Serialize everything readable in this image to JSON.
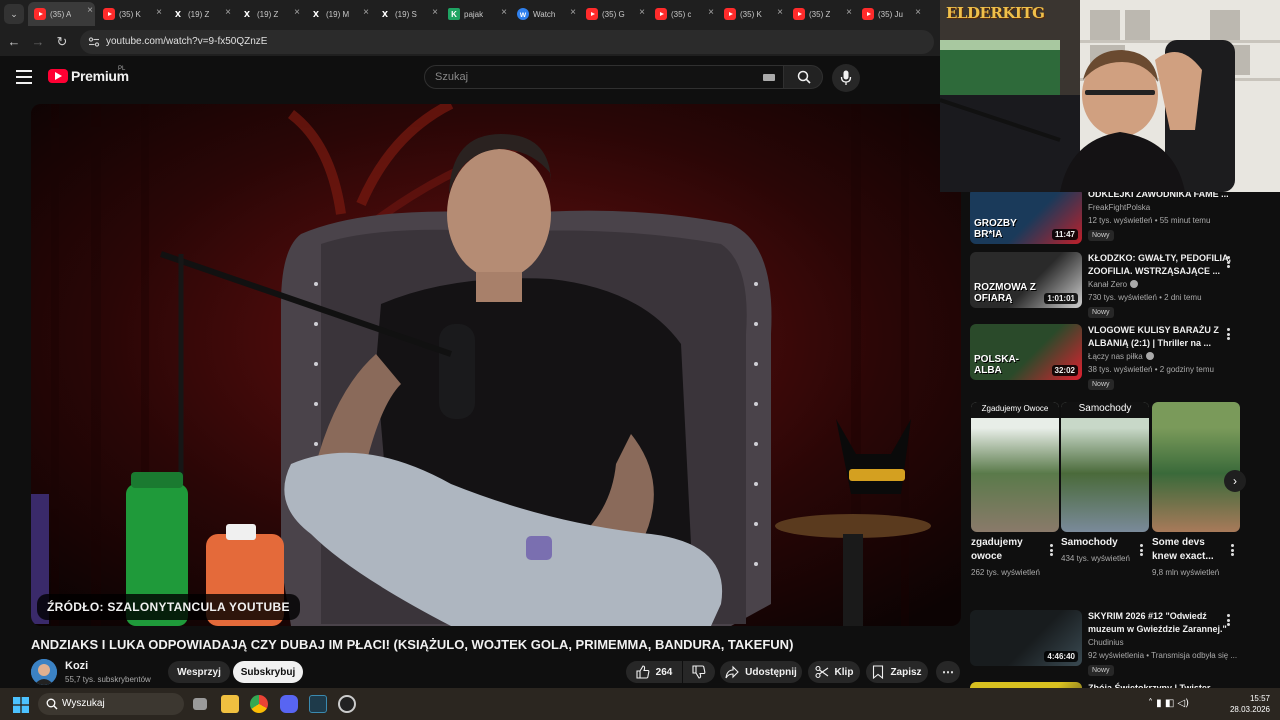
{
  "browser": {
    "tabs": [
      {
        "icon": "youtube-icon",
        "label": "(35) A"
      },
      {
        "icon": "youtube-icon",
        "label": "(35) K"
      },
      {
        "icon": "x-icon",
        "label": "(19) Z"
      },
      {
        "icon": "x-icon",
        "label": "(19) Z"
      },
      {
        "icon": "x-icon",
        "label": "(19) M"
      },
      {
        "icon": "x-icon",
        "label": "(19) S"
      },
      {
        "icon": "kick-icon",
        "label": "pajak"
      },
      {
        "icon": "watch-icon",
        "label": "Watch"
      },
      {
        "icon": "youtube-icon",
        "label": "(35) G"
      },
      {
        "icon": "youtube-icon",
        "label": "(35) c"
      },
      {
        "icon": "youtube-icon",
        "label": "(35) K"
      },
      {
        "icon": "youtube-icon",
        "label": "(35) Z"
      },
      {
        "icon": "youtube-icon",
        "label": "(35) Ju"
      }
    ],
    "url": "youtube.com/watch?v=9-fx50QZnzE"
  },
  "youtube": {
    "logo_text": "Premium",
    "logo_country": "PL",
    "search_placeholder": "Szukaj"
  },
  "video": {
    "source_caption": "ŹRÓDŁO: SZALONYTANCULA YOUTUBE",
    "title": "ANDZIAKS I LUKA ODPOWIADAJĄ CZY DUBAJ IM PŁACI! (KSIĄŻULO, WOJTEK GOLA, PRIMEMMA, BANDURA, TAKEFUN)",
    "channel_name": "Kozi",
    "channel_subscribers": "55,7 tys. subskrybentów",
    "support_label": "Wesprzyj",
    "subscribe_label": "Subskrybuj",
    "like_count": "264",
    "share_label": "Udostępnij",
    "clip_label": "Klip",
    "save_label": "Zapisz"
  },
  "facecam": {
    "logo": "ELDERKITG"
  },
  "recommendations": [
    {
      "title": "ODKLEJKI ZAWODNIKA FAME ...",
      "channel": "FreakFightPolska",
      "verified": false,
      "stats": "12 tys. wyświetleń • 55 minut temu",
      "badge": "Nowy",
      "duration": "11:47",
      "thumb_text": "GROZBY BR*IA"
    },
    {
      "title": "KŁODZKO: GWAŁTY, PEDOFILIA, ZOOFILIA. WSTRZĄSAJĄCE ...",
      "channel": "Kanał Zero",
      "verified": true,
      "stats": "730 tys. wyświetleń • 2 dni temu",
      "badge": "Nowy",
      "duration": "1:01:01",
      "thumb_text": "ROZMOWA Z OFIARĄ"
    },
    {
      "title": "VLOGOWE KULISY BARAŻU Z ALBANIĄ (2:1) | Thriller na ...",
      "channel": "Łączy nas piłka",
      "verified": true,
      "stats": "38 tys. wyświetleń • 2 godziny temu",
      "badge": "Nowy",
      "duration": "32:02",
      "thumb_text": "POLSKA-ALBA"
    },
    {
      "title": "SKYRIM 2026 #12 \"Odwiedź muzeum w Gwieździe Zarannej.\"",
      "channel": "Chudinius",
      "verified": false,
      "stats": "92 wyświetlenia • Transmisja odbyła się ...",
      "badge": "Nowy",
      "duration": "4:46:40",
      "thumb_text": ""
    },
    {
      "title": "Zbója Świętokrzyny | Twister ...",
      "channel": "",
      "verified": false,
      "stats": "",
      "badge": "",
      "duration": "",
      "thumb_text": ""
    }
  ],
  "shorts": [
    {
      "title": "zgadujemy owoce",
      "views": "262 tys. wyświetleń",
      "thumb_caption": "Zgadujemy Owoce"
    },
    {
      "title": "Samochody",
      "views": "434 tys. wyświetleń",
      "thumb_caption": "Samochody"
    },
    {
      "title": "Some devs knew exact...",
      "views": "9,8 mln wyświetleń",
      "thumb_caption": ""
    }
  ],
  "taskbar": {
    "search_label": "Wyszukaj",
    "time": "15:57",
    "date": "28.03.2026"
  },
  "colors": {
    "youtube_red": "#ff0033",
    "background": "#0f0f0f",
    "taskbar": "#2b2620"
  }
}
